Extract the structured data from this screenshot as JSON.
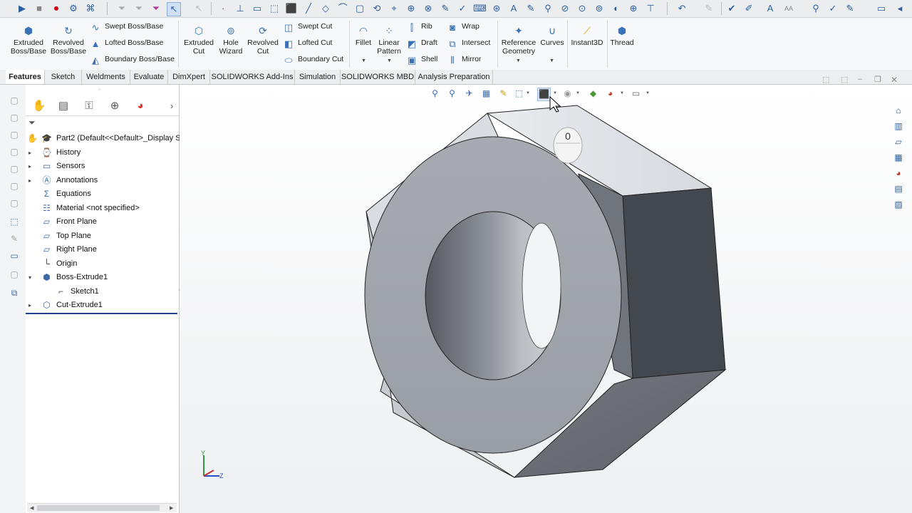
{
  "quick_toolbar": {
    "icons": [
      "play-icon",
      "stop-icon",
      "record-icon",
      "macro-edit-icon",
      "macro-icon",
      "filter-icon",
      "filter2-icon",
      "filter3-icon",
      "select-arrow-icon",
      "select-filter-icon",
      "point-icon",
      "axis-icon",
      "plane-icon",
      "box-icon",
      "line-icon",
      "rectangle-icon",
      "corner-rect-icon",
      "arc-icon",
      "circle-icon",
      "polygon-icon",
      "trim-icon",
      "smart-dimension-icon",
      "zoom-icon",
      "text-icon",
      "offset-icon",
      "sketch-icon",
      "dimension-icon",
      "mirror-icon",
      "rotate-icon",
      "move-icon",
      "pattern-icon",
      "relation-icon",
      "pen-icon",
      "spelling-icon",
      "brush-icon",
      "font-icon",
      "aa-icon",
      "search-icon",
      "check-icon",
      "pin-icon",
      "collapse-icon"
    ]
  },
  "ribbon": {
    "extruded_boss": "Extruded Boss/Base",
    "revolved_boss": "Revolved Boss/Base",
    "swept_boss": "Swept Boss/Base",
    "lofted_boss": "Lofted Boss/Base",
    "boundary_boss": "Boundary Boss/Base",
    "extruded_cut": "Extruded Cut",
    "hole_wizard": "Hole Wizard",
    "revolved_cut": "Revolved Cut",
    "swept_cut": "Swept Cut",
    "lofted_cut": "Lofted Cut",
    "boundary_cut": "Boundary Cut",
    "fillet": "Fillet",
    "linear_pattern": "Linear Pattern",
    "rib": "Rib",
    "draft": "Draft",
    "shell": "Shell",
    "wrap": "Wrap",
    "intersect": "Intersect",
    "mirror": "Mirror",
    "reference_geometry": "Reference Geometry",
    "curves": "Curves",
    "instant3d": "Instant3D",
    "thread": "Thread"
  },
  "tabs": [
    "Features",
    "Sketch",
    "Weldments",
    "Evaluate",
    "DimXpert",
    "SOLIDWORKS Add-Ins",
    "Simulation",
    "SOLIDWORKS MBD",
    "Analysis Preparation"
  ],
  "feature_tree": {
    "root": "Part2  (Default<<Default>_Display S",
    "items": [
      "History",
      "Sensors",
      "Annotations",
      "Equations",
      "Material <not specified>",
      "Front Plane",
      "Top Plane",
      "Right Plane",
      "Origin",
      "Boss-Extrude1",
      "Sketch1",
      "Cut-Extrude1"
    ]
  },
  "viewport": {
    "mouse_hint": "0",
    "triad_y": "Y",
    "triad_z": "Z"
  },
  "colors": {
    "accent": "#2c5f9e",
    "model_face_light": "#b7bac0",
    "model_face_dark": "#4a4e55",
    "ribbon_bg": "#f7f8f9",
    "selection_bar": "#1f3f8a"
  }
}
